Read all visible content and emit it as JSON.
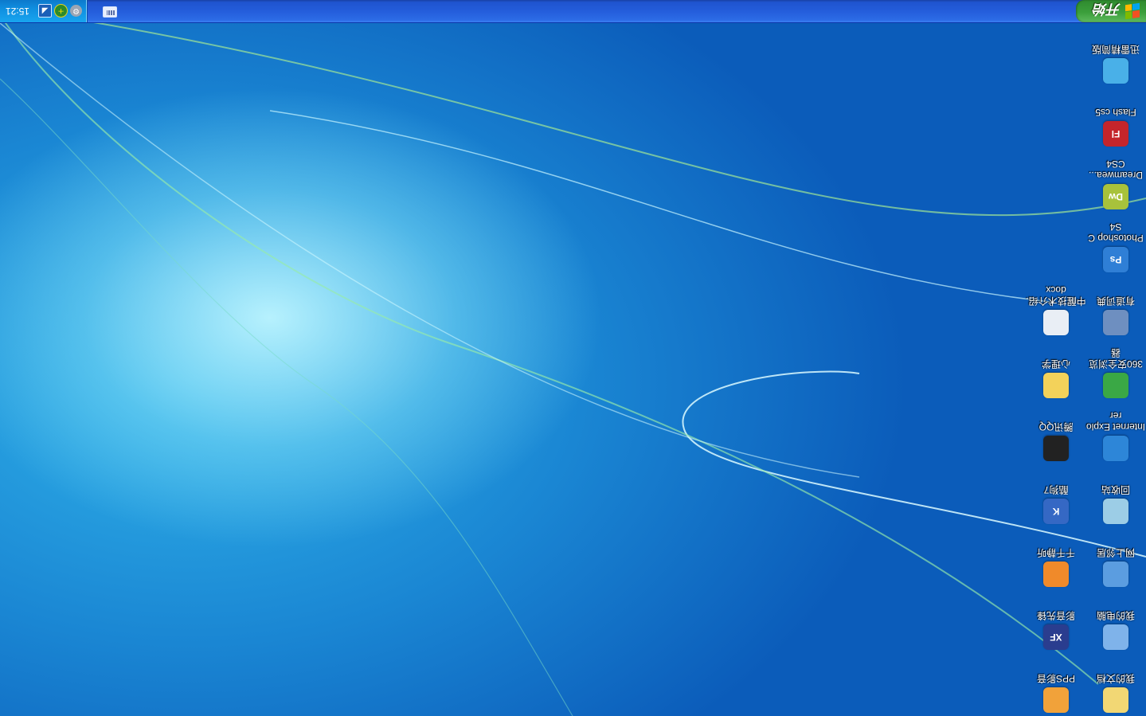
{
  "display": {
    "orientation": "rotated 180 degrees"
  },
  "taskbar": {
    "start_label": "开始",
    "clock": "15:21",
    "tray_icons": [
      "gear-icon",
      "security-guard-icon",
      "network-icon"
    ]
  },
  "desktop": {
    "icons": [
      {
        "label": "我的文档",
        "icon": "folder-document-icon",
        "color": "#f2d774"
      },
      {
        "label": "我的电脑",
        "icon": "computer-icon",
        "color": "#7fb3ea"
      },
      {
        "label": "网上邻居",
        "icon": "network-neighborhood-icon",
        "color": "#5b9de0"
      },
      {
        "label": "回收站",
        "icon": "recycle-bin-icon",
        "color": "#9ccde6"
      },
      {
        "label": "Internet Explorer",
        "icon": "internet-explorer-icon",
        "color": "#2d86d8"
      },
      {
        "label": "360安全浏览器",
        "icon": "360-browser-icon",
        "color": "#3aa845"
      },
      {
        "label": "有道词典",
        "icon": "youdao-dictionary-icon",
        "color": "#6e8fc0"
      },
      {
        "label": "Photoshop CS4",
        "icon": "photoshop-icon",
        "color": "#2f7fd6",
        "glyph": "Ps"
      },
      {
        "label": "Dreamwea... CS4",
        "icon": "dreamweaver-icon",
        "color": "#a8c23b",
        "glyph": "Dw"
      },
      {
        "label": "Flash cs5",
        "icon": "flash-icon",
        "color": "#c4252b",
        "glyph": "Fl"
      },
      {
        "label": "迅雷精简版",
        "icon": "xunlei-icon",
        "color": "#49b0e8"
      },
      {
        "label": "PPS影音",
        "icon": "pps-player-icon",
        "color": "#f1a23a"
      },
      {
        "label": "影音先锋",
        "icon": "xfplay-icon",
        "color": "#2a3d8f",
        "glyph": "XF"
      },
      {
        "label": "千千静听",
        "icon": "ttplayer-icon",
        "color": "#f08a2a"
      },
      {
        "label": "酷狗7",
        "icon": "kugou-icon",
        "color": "#3568c4",
        "glyph": "K"
      },
      {
        "label": "腾讯QQ",
        "icon": "qq-penguin-icon",
        "color": "#222222"
      },
      {
        "label": "心理学",
        "icon": "folder-icon",
        "color": "#f3d25a"
      },
      {
        "label": "中醒技术介绍.docx",
        "icon": "word-document-icon",
        "color": "#e9eef5"
      }
    ]
  }
}
